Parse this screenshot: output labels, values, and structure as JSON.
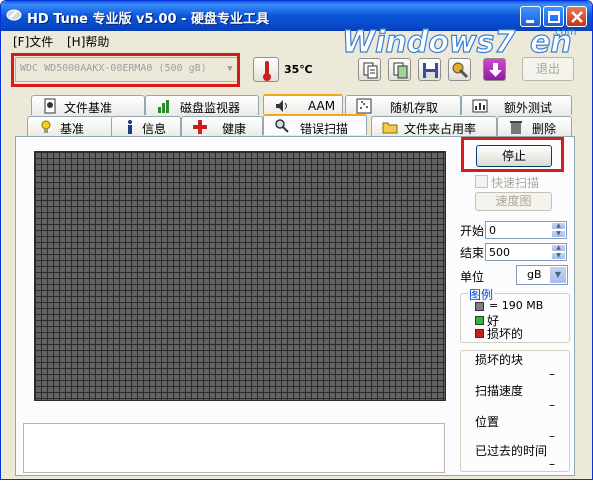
{
  "window": {
    "title": "HD Tune 专业版 v5.00 - 硬盘专业工具"
  },
  "logo": {
    "text_main": "Windows7",
    "text_en": "en",
    "text_sub": ".com"
  },
  "menu": {
    "file": "[F]文件",
    "help": "[H]帮助"
  },
  "toolbar": {
    "drive": "WDC WD5000AAKX-00ERMA0 (500 gB)",
    "temperature": "35℃",
    "exit": "退出"
  },
  "tabs_top": [
    {
      "label": "文件基准",
      "icon": "file-benchmark-icon"
    },
    {
      "label": "磁盘监视器",
      "icon": "disk-monitor-icon"
    },
    {
      "label": "AAM",
      "icon": "speaker-icon"
    },
    {
      "label": "随机存取",
      "icon": "random-access-icon"
    },
    {
      "label": "额外测试",
      "icon": "extra-tests-icon"
    }
  ],
  "tabs_bottom": [
    {
      "label": "基准",
      "icon": "benchmark-icon"
    },
    {
      "label": "信息",
      "icon": "info-icon"
    },
    {
      "label": "健康",
      "icon": "health-icon"
    },
    {
      "label": "错误扫描",
      "icon": "error-scan-icon",
      "active": true
    },
    {
      "label": "文件夹占用率",
      "icon": "folder-usage-icon"
    },
    {
      "label": "删除",
      "icon": "erase-icon"
    }
  ],
  "scan": {
    "stop": "停止",
    "quick_scan": "快速扫描",
    "speed_map": "速度图",
    "start_label": "开始",
    "start_value": "0",
    "end_label": "结束",
    "end_value": "500",
    "unit_label": "单位",
    "unit_value": "gB"
  },
  "legend": {
    "title": "图例",
    "block_size": "= 190 MB",
    "good": "好",
    "bad": "损坏的",
    "colors": {
      "block": "#808080",
      "good": "#2db82d",
      "bad": "#c81e1e"
    }
  },
  "stats": [
    {
      "label": "损坏的块",
      "value": "–"
    },
    {
      "label": "扫描速度",
      "value": "–"
    },
    {
      "label": "位置",
      "value": "–"
    },
    {
      "label": "已过去的时间",
      "value": "–"
    }
  ]
}
